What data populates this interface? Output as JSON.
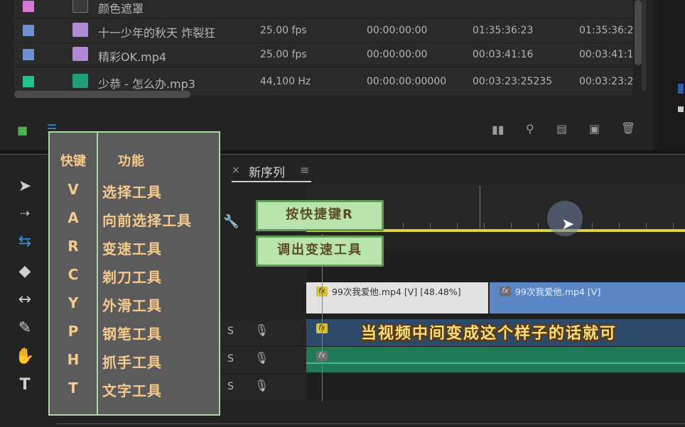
{
  "project": {
    "rows": [
      {
        "name": "颜色遮罩",
        "fps": "",
        "media_start": "",
        "media_end": "",
        "duration": "",
        "swatch": "#d977d9",
        "icon": "color-matte-icon",
        "icon_color": "#3a3a3a"
      },
      {
        "name": "十一少年的秋天 炸裂狂",
        "fps": "25.00 fps",
        "media_start": "00:00:00:00",
        "media_end": "01:35:36:23",
        "duration": "01:35:36:2",
        "swatch": "#6f8fcf",
        "icon": "sequence-icon",
        "icon_color": "#b18ad6"
      },
      {
        "name": "精彩OK.mp4",
        "fps": "25.00 fps",
        "media_start": "00:00:00:00",
        "media_end": "00:03:41:16",
        "duration": "00:03:41:1",
        "swatch": "#6f8fcf",
        "icon": "video-clip-icon",
        "icon_color": "#b18ad6"
      },
      {
        "name": "少恭 - 怎么办.mp3",
        "fps": "44,100 Hz",
        "media_start": "00:00:00:00000",
        "media_end": "00:03:23:25235",
        "duration": "00:03:23:2",
        "swatch": "#23c28a",
        "icon": "audio-clip-icon",
        "icon_color": "#1f9e7a"
      }
    ]
  },
  "timeline": {
    "sequence_tab": "新序列",
    "tab_close": "×",
    "clips": {
      "v1a": "99次我爱他.mp4 [V] [48.48%]",
      "v1b": "99次我爱他.mp4 [V]",
      "fx": "fx"
    },
    "track_s": "S"
  },
  "shortcut_table": {
    "header_key": "快键",
    "header_fn": "功能",
    "rows": [
      {
        "key": "V",
        "fn": "选择工具"
      },
      {
        "key": "A",
        "fn": "向前选择工具"
      },
      {
        "key": "R",
        "fn": "变速工具"
      },
      {
        "key": "C",
        "fn": "剃刀工具"
      },
      {
        "key": "Y",
        "fn": "外滑工具"
      },
      {
        "key": "P",
        "fn": "钢笔工具"
      },
      {
        "key": "H",
        "fn": "抓手工具"
      },
      {
        "key": "T",
        "fn": "文字工具"
      }
    ]
  },
  "callouts": {
    "top": "按快捷键R",
    "bottom": "调出变速工具"
  },
  "subtitle": "当视频中间变成这个样子的话就可",
  "colors": {
    "accent_blue": "#2a5b9e",
    "work_area": "#d8d24a",
    "callout_bg": "#b9e3ad",
    "table_text": "#f6c98c"
  }
}
